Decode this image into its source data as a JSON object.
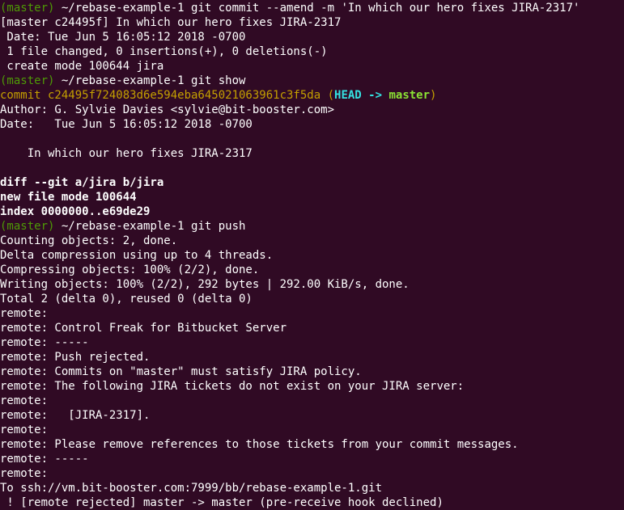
{
  "theme": {
    "background": "#300a24",
    "foreground": "#ffffff",
    "prompt_color": "#4e9a06",
    "commit_color": "#c4a000",
    "head_color": "#34e2e2",
    "branch_color": "#8ae234"
  },
  "lines": [
    {
      "type": "prompt",
      "branch": "(master)",
      "text": " ~/rebase-example-1 git commit --amend -m 'In which our hero fixes JIRA-2317'"
    },
    {
      "type": "plain",
      "text": "[master c24495f] In which our hero fixes JIRA-2317"
    },
    {
      "type": "plain",
      "text": " Date: Tue Jun 5 16:05:12 2018 -0700"
    },
    {
      "type": "plain",
      "text": " 1 file changed, 0 insertions(+), 0 deletions(-)"
    },
    {
      "type": "plain",
      "text": " create mode 100644 jira"
    },
    {
      "type": "prompt",
      "branch": "(master)",
      "text": " ~/rebase-example-1 git show"
    },
    {
      "type": "commit",
      "hash": "commit c24495f724083d6e594eba645021063961c3f5da",
      "open": " (",
      "head": "HEAD ->",
      "space": " ",
      "master": "master",
      "close": ")"
    },
    {
      "type": "plain",
      "text": "Author: G. Sylvie Davies <sylvie@bit-booster.com>"
    },
    {
      "type": "plain",
      "text": "Date:   Tue Jun 5 16:05:12 2018 -0700"
    },
    {
      "type": "plain",
      "text": ""
    },
    {
      "type": "plain",
      "text": "    In which our hero fixes JIRA-2317"
    },
    {
      "type": "plain",
      "text": ""
    },
    {
      "type": "bold",
      "text": "diff --git a/jira b/jira"
    },
    {
      "type": "bold",
      "text": "new file mode 100644"
    },
    {
      "type": "bold",
      "text": "index 0000000..e69de29"
    },
    {
      "type": "prompt",
      "branch": "(master)",
      "text": " ~/rebase-example-1 git push"
    },
    {
      "type": "plain",
      "text": "Counting objects: 2, done."
    },
    {
      "type": "plain",
      "text": "Delta compression using up to 4 threads."
    },
    {
      "type": "plain",
      "text": "Compressing objects: 100% (2/2), done."
    },
    {
      "type": "plain",
      "text": "Writing objects: 100% (2/2), 292 bytes | 292.00 KiB/s, done."
    },
    {
      "type": "plain",
      "text": "Total 2 (delta 0), reused 0 (delta 0)"
    },
    {
      "type": "plain",
      "text": "remote:"
    },
    {
      "type": "plain",
      "text": "remote: Control Freak for Bitbucket Server"
    },
    {
      "type": "plain",
      "text": "remote: -----"
    },
    {
      "type": "plain",
      "text": "remote: Push rejected."
    },
    {
      "type": "plain",
      "text": "remote: Commits on \"master\" must satisfy JIRA policy."
    },
    {
      "type": "plain",
      "text": "remote: The following JIRA tickets do not exist on your JIRA server:"
    },
    {
      "type": "plain",
      "text": "remote:"
    },
    {
      "type": "plain",
      "text": "remote:   [JIRA-2317]."
    },
    {
      "type": "plain",
      "text": "remote:"
    },
    {
      "type": "plain",
      "text": "remote: Please remove references to those tickets from your commit messages."
    },
    {
      "type": "plain",
      "text": "remote: -----"
    },
    {
      "type": "plain",
      "text": "remote:"
    },
    {
      "type": "plain",
      "text": "To ssh://vm.bit-booster.com:7999/bb/rebase-example-1.git"
    },
    {
      "type": "plain",
      "text": " ! [remote rejected] master -> master (pre-receive hook declined)"
    }
  ]
}
